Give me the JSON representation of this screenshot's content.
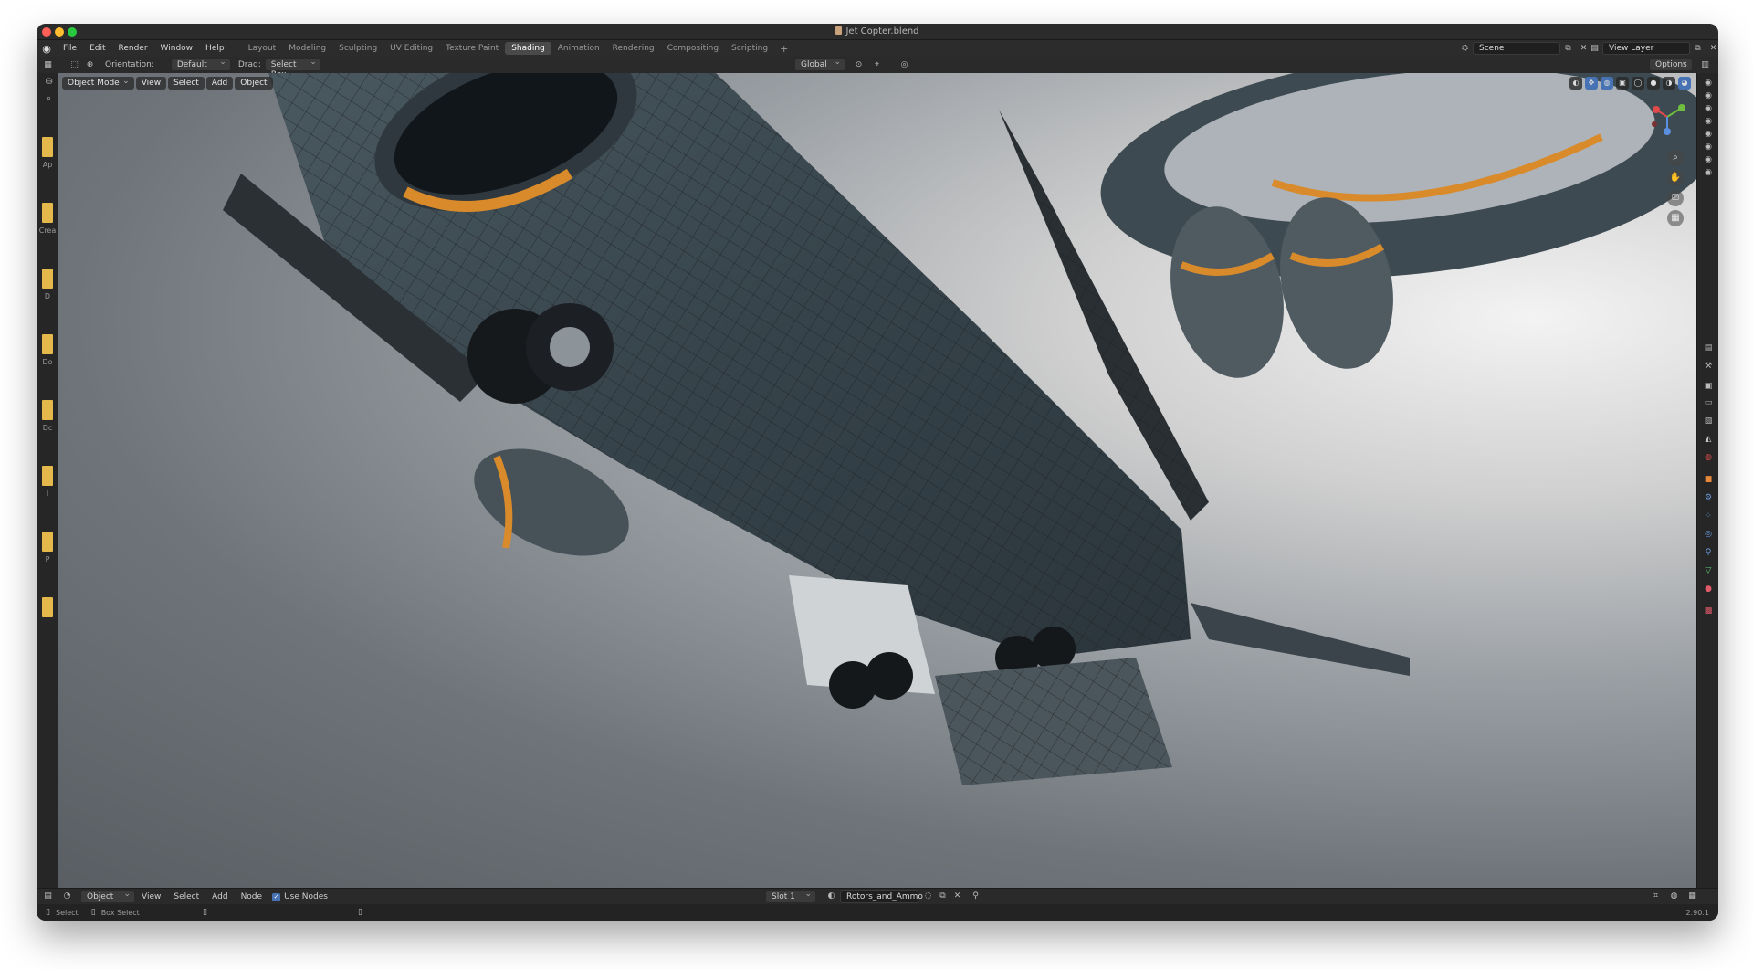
{
  "window": {
    "title": "Jet Copter.blend"
  },
  "topbar": {
    "menus": [
      "File",
      "Edit",
      "Render",
      "Window",
      "Help"
    ],
    "workspaces": [
      "Layout",
      "Modeling",
      "Sculpting",
      "UV Editing",
      "Texture Paint",
      "Shading",
      "Animation",
      "Rendering",
      "Compositing",
      "Scripting"
    ],
    "active_workspace": "Shading",
    "add_tab": "+",
    "scene": "Scene",
    "view_layer": "View Layer"
  },
  "toolheader": {
    "orientation_label": "Orientation:",
    "orientation_value": "Default",
    "drag_label": "Drag:",
    "drag_value": "Select Box",
    "transform_orientation": "Global",
    "options": "Options"
  },
  "viewport": {
    "mode": "Object Mode",
    "menus": [
      "View",
      "Select",
      "Add",
      "Object"
    ]
  },
  "left_strip_labels": [
    "Ap",
    "Crea",
    "D",
    "Do",
    "Dc",
    "I",
    "P"
  ],
  "node_editor_header": {
    "editor_type": "Object",
    "menus": [
      "View",
      "Select",
      "Add",
      "Node"
    ],
    "use_nodes_label": "Use Nodes",
    "slot": "Slot 1",
    "material": "Rotors_and_Ammo"
  },
  "statusbar": {
    "select": "Select",
    "box_select": "Box Select",
    "version": "2.90.1"
  },
  "colors": {
    "accent": "#4772b3",
    "header_bg": "#2a2a2a",
    "orange_trim": "#d98b2b"
  }
}
